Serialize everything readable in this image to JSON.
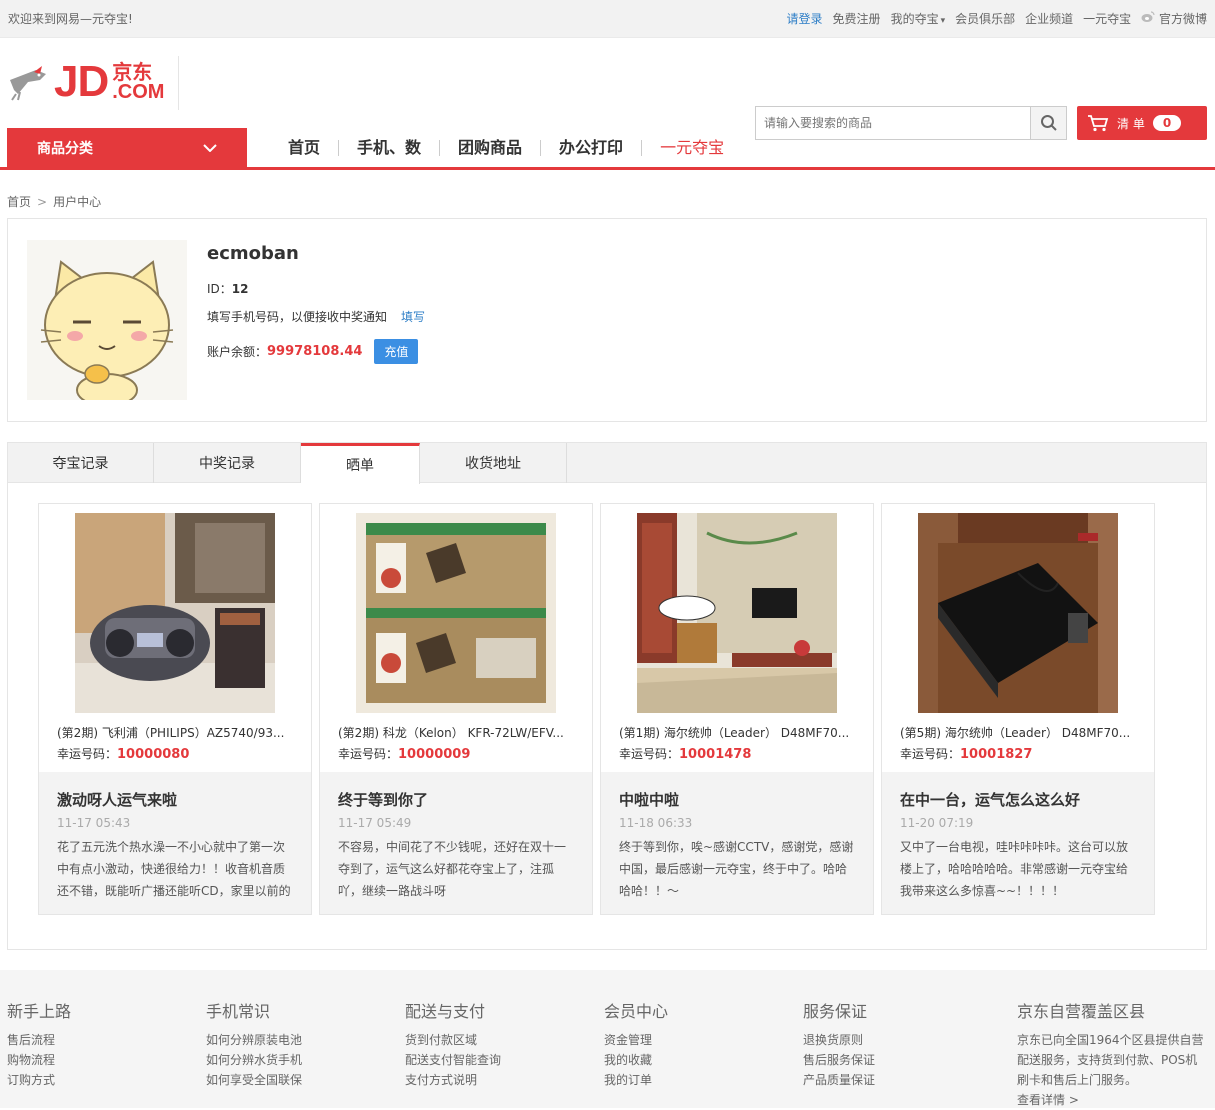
{
  "topbar": {
    "welcome": "欢迎来到网易—元夺宝!",
    "login": "请登录",
    "register": "免费注册",
    "my_duobao": "我的夺宝",
    "member_club": "会员俱乐部",
    "enterprise": "企业频道",
    "yiyuan": "一元夺宝",
    "weibo": "官方微博"
  },
  "header": {
    "logo_jd": "JD",
    "logo_cn": "京东",
    "logo_com": ".COM",
    "search_placeholder": "请输入要搜索的商品",
    "cart_label": "清 单",
    "cart_count": "0"
  },
  "nav": {
    "category": "商品分类",
    "items": [
      "首页",
      "手机、数",
      "团购商品",
      "办公打印",
      "一元夺宝"
    ]
  },
  "breadcrumb": {
    "home": "首页",
    "current": "用户中心"
  },
  "user": {
    "name": "ecmoban",
    "id_label": "ID：",
    "id_value": "12",
    "phone_hint": "填写手机号码，以便接收中奖通知",
    "phone_fill": "填写",
    "balance_label": "账户余额：",
    "balance_value": "99978108.44",
    "recharge": "充值"
  },
  "tabs": [
    {
      "label": "夺宝记录",
      "active": false
    },
    {
      "label": "中奖记录",
      "active": false
    },
    {
      "label": "晒单",
      "active": true
    },
    {
      "label": "收货地址",
      "active": false
    }
  ],
  "cards": [
    {
      "title": "(第2期) 飞利浦（PHILIPS）AZ5740/93...",
      "lucky_label": "幸运号码：",
      "lucky": "10000080",
      "post_title": "激动呀人运气来啦",
      "time": "11-17 05:43",
      "desc": "花了五元洗个热水澡一不小心就中了第一次中有点小激动，快递很给力！！收音机音质还不错，既能听广播还能听CD，家里以前的",
      "image": "radio-photo"
    },
    {
      "title": "(第2期) 科龙（Kelon） KFR-72LW/EFV...",
      "lucky_label": "幸运号码：",
      "lucky": "10000009",
      "post_title": "终于等到你了",
      "time": "11-17 05:49",
      "desc": "不容易，中间花了不少钱呢，还好在双十一夺到了，运气这么好都花夺宝上了，注孤吖，继续一路战斗呀",
      "image": "box-photo"
    },
    {
      "title": "(第1期) 海尔统帅（Leader） D48MF70...",
      "lucky_label": "幸运号码：",
      "lucky": "10001478",
      "post_title": "中啦中啦",
      "time": "11-18 06:33",
      "desc": "终于等到你，唉~感谢CCTV，感谢党，感谢中国，最后感谢一元夺宝，终于中了。哈哈哈哈！！～",
      "image": "tv-room-photo"
    },
    {
      "title": "(第5期) 海尔统帅（Leader） D48MF70...",
      "lucky_label": "幸运号码：",
      "lucky": "10001827",
      "post_title": "在中一台，运气怎么这么好",
      "time": "11-20 07:19",
      "desc": "又中了一台电视，哇咔咔咔咔。这台可以放楼上了，哈哈哈哈哈。非常感谢一元夺宝给我带来这么多惊喜~~！！！！",
      "image": "tv-box-photo"
    }
  ],
  "footer": {
    "cols": [
      {
        "title": "新手上路",
        "links": [
          "售后流程",
          "购物流程",
          "订购方式"
        ]
      },
      {
        "title": "手机常识",
        "links": [
          "如何分辨原装电池",
          "如何分辨水货手机",
          "如何享受全国联保"
        ]
      },
      {
        "title": "配送与支付",
        "links": [
          "货到付款区域",
          "配送支付智能查询",
          "支付方式说明"
        ]
      },
      {
        "title": "会员中心",
        "links": [
          "资金管理",
          "我的收藏",
          "我的订单"
        ]
      },
      {
        "title": "服务保证",
        "links": [
          "退换货原则",
          "售后服务保证",
          "产品质量保证"
        ]
      }
    ],
    "coverage_title": "京东自营覆盖区县",
    "coverage_desc": "京东已向全国1964个区县提供自营配送服务，支持货到付款、POS机刷卡和售后上门服务。",
    "coverage_more": "查看详情 >"
  },
  "colors": {
    "accent": "#e4393c",
    "link": "#2f7fc7",
    "button": "#3b8fe3"
  }
}
